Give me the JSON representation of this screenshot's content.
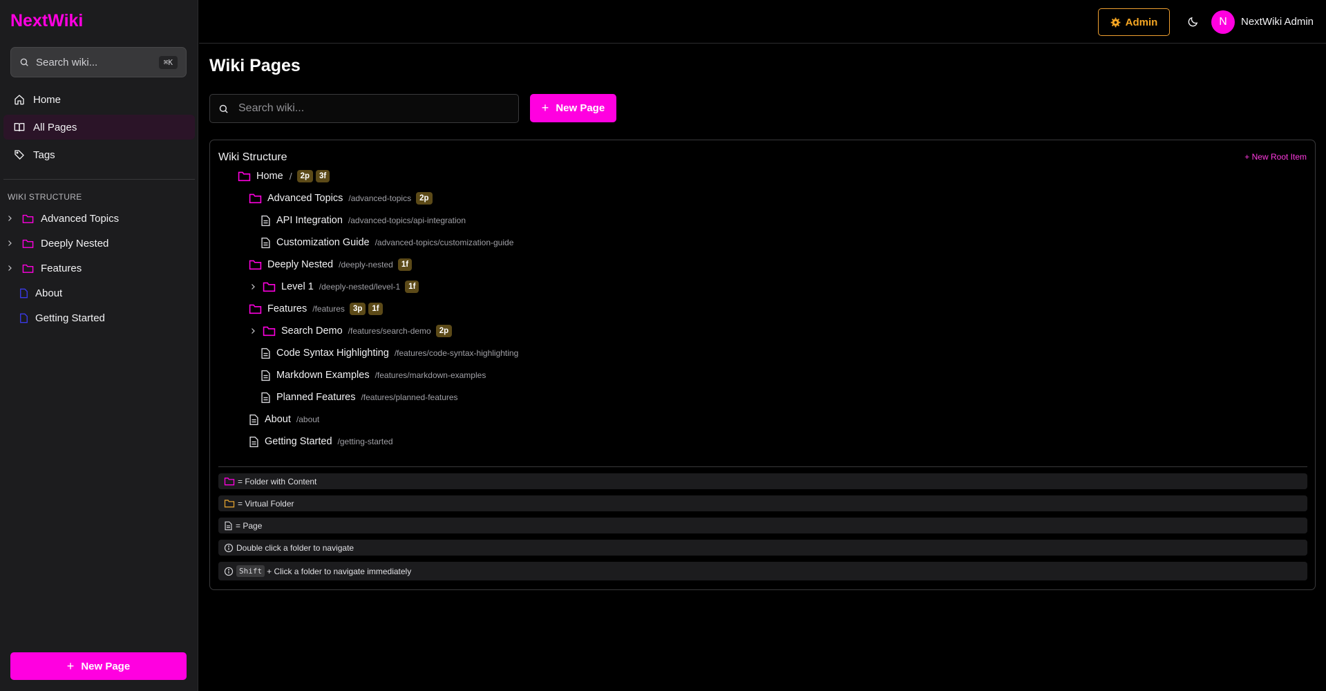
{
  "app": {
    "brand": "NextWiki"
  },
  "sidebar": {
    "search_placeholder": "Search wiki...",
    "search_shortcut": "⌘K",
    "nav": [
      {
        "label": "Home",
        "icon": "home-icon"
      },
      {
        "label": "All Pages",
        "icon": "book-open-icon",
        "active": true
      },
      {
        "label": "Tags",
        "icon": "tag-icon"
      }
    ],
    "structure_heading": "WIKI STRUCTURE",
    "structure": [
      {
        "label": "Advanced Topics",
        "type": "folder",
        "expandable": true
      },
      {
        "label": "Deeply Nested",
        "type": "folder",
        "expandable": true
      },
      {
        "label": "Features",
        "type": "folder",
        "expandable": true
      },
      {
        "label": "About",
        "type": "page"
      },
      {
        "label": "Getting Started",
        "type": "page"
      }
    ],
    "new_page_label": "New Page"
  },
  "header": {
    "admin_label": "Admin",
    "avatar_initial": "N",
    "user_name": "NextWiki Admin"
  },
  "main": {
    "title": "Wiki Pages",
    "search_placeholder": "Search wiki...",
    "new_page_label": "New Page",
    "structure_card": {
      "title": "Wiki Structure",
      "new_root_label": "+ New Root Item",
      "tree": [
        {
          "name": "Home",
          "sep": "/",
          "badges": [
            "2p",
            "3f"
          ],
          "type": "folder"
        },
        {
          "name": "Advanced Topics",
          "path": "/advanced-topics",
          "badges": [
            "2p"
          ],
          "type": "folder"
        },
        {
          "name": "API Integration",
          "path": "/advanced-topics/api-integration",
          "type": "page"
        },
        {
          "name": "Customization Guide",
          "path": "/advanced-topics/customization-guide",
          "type": "page"
        },
        {
          "name": "Deeply Nested",
          "path": "/deeply-nested",
          "badges": [
            "1f"
          ],
          "type": "folder"
        },
        {
          "name": "Level 1",
          "path": "/deeply-nested/level-1",
          "badges": [
            "1f"
          ],
          "type": "folder",
          "expandable": true
        },
        {
          "name": "Features",
          "path": "/features",
          "badges": [
            "3p",
            "1f"
          ],
          "type": "folder"
        },
        {
          "name": "Search Demo",
          "path": "/features/search-demo",
          "badges": [
            "2p"
          ],
          "type": "folder",
          "expandable": true
        },
        {
          "name": "Code Syntax Highlighting",
          "path": "/features/code-syntax-highlighting",
          "type": "page"
        },
        {
          "name": "Markdown Examples",
          "path": "/features/markdown-examples",
          "type": "page"
        },
        {
          "name": "Planned Features",
          "path": "/features/planned-features",
          "type": "page"
        },
        {
          "name": "About",
          "path": "/about",
          "type": "page"
        },
        {
          "name": "Getting Started",
          "path": "/getting-started",
          "type": "page"
        }
      ],
      "legend": [
        {
          "text": "= Folder with Content",
          "icon": "folder-content-icon"
        },
        {
          "text": "= Virtual Folder",
          "icon": "folder-virtual-icon"
        },
        {
          "text": "= Page",
          "icon": "page-icon"
        },
        {
          "text": "Double click a folder to navigate",
          "icon": "info-icon"
        },
        {
          "text": "+ Click a folder to navigate immediately",
          "icon": "info-icon",
          "key": "Shift"
        }
      ]
    }
  },
  "colors": {
    "accent": "#ff00e0",
    "admin": "#f5a623",
    "badge": "#5c4a18",
    "page_icon_sidebar": "#3a3ae8",
    "virtual_folder": "#e0a030"
  }
}
